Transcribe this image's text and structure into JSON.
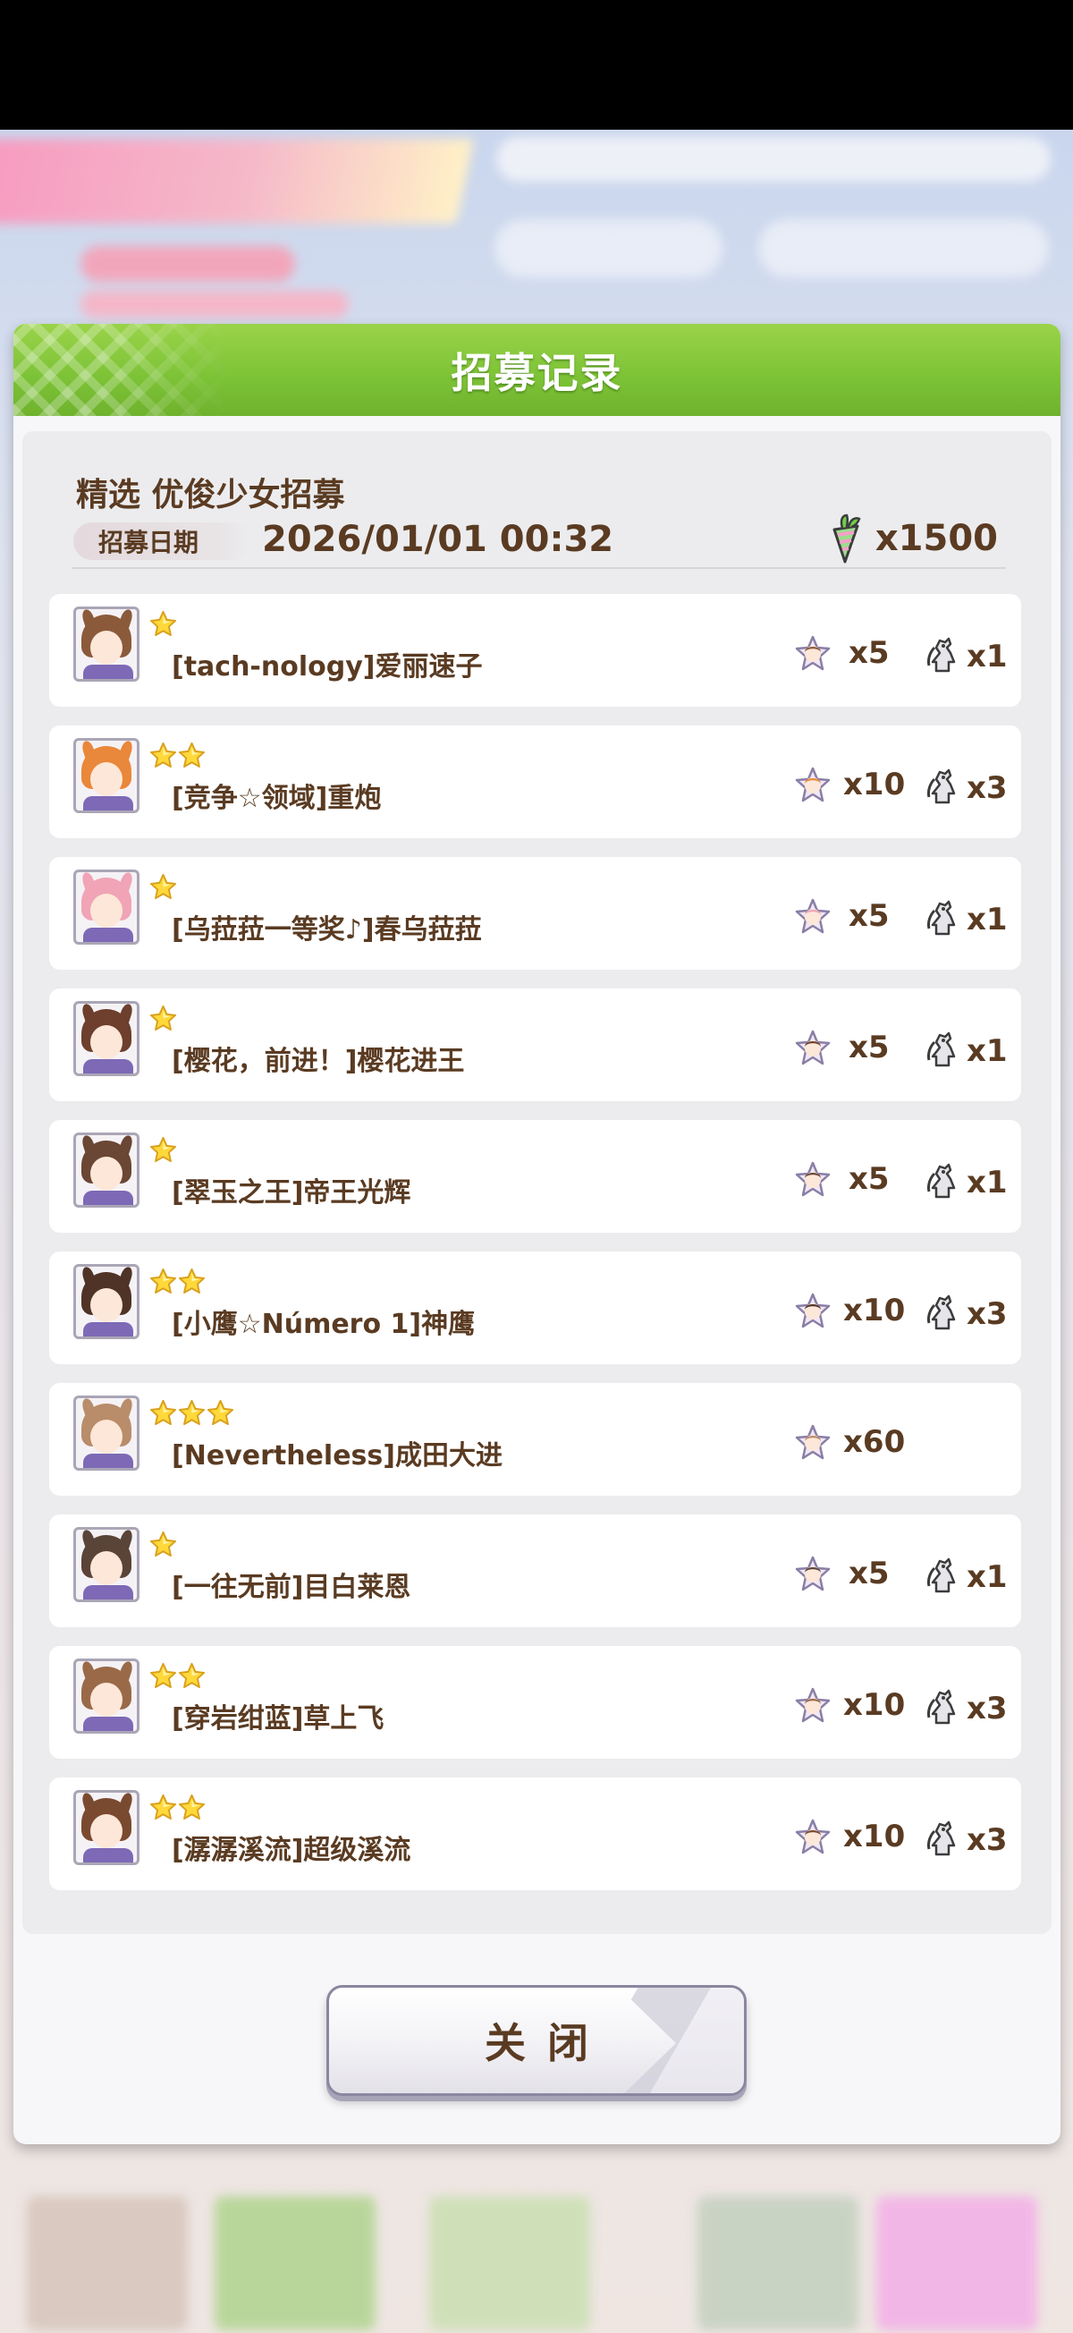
{
  "modal": {
    "title": "招募记录",
    "gacha_name": "精选  优俊少女招募",
    "date_label": "招募日期",
    "date_value": "2026/01/01  00:32",
    "cost_value": "x1500",
    "close_label": "关闭"
  },
  "results": [
    {
      "rarity": 1,
      "name": "[tach-nology]爱丽速子",
      "pieces": "x5",
      "memory": "x1",
      "hair": "#8b5a3a"
    },
    {
      "rarity": 2,
      "name": "[竞争☆领域]重炮",
      "pieces": "x10",
      "memory": "x3",
      "hair": "#e9873a"
    },
    {
      "rarity": 1,
      "name": "[乌菈菈一等奖♪]春乌菈菈",
      "pieces": "x5",
      "memory": "x1",
      "hair": "#f0a4b6"
    },
    {
      "rarity": 1,
      "name": "[樱花，前进！]樱花进王",
      "pieces": "x5",
      "memory": "x1",
      "hair": "#6d3f2c"
    },
    {
      "rarity": 1,
      "name": "[翠玉之王]帝王光辉",
      "pieces": "x5",
      "memory": "x1",
      "hair": "#6a4634"
    },
    {
      "rarity": 2,
      "name": "[小鹰☆Número 1]神鹰",
      "pieces": "x10",
      "memory": "x3",
      "hair": "#4f3326"
    },
    {
      "rarity": 3,
      "name": "[Nevertheless]成田大进",
      "pieces": "x60",
      "memory": "",
      "hair": "#b98c6a"
    },
    {
      "rarity": 1,
      "name": "[一往无前]目白莱恩",
      "pieces": "x5",
      "memory": "x1",
      "hair": "#5a4438"
    },
    {
      "rarity": 2,
      "name": "[穿岩绀蓝]草上飞",
      "pieces": "x10",
      "memory": "x3",
      "hair": "#9a6a48"
    },
    {
      "rarity": 2,
      "name": "[潺潺溪流]超级溪流",
      "pieces": "x10",
      "memory": "x3",
      "hair": "#7a4a30"
    }
  ]
}
